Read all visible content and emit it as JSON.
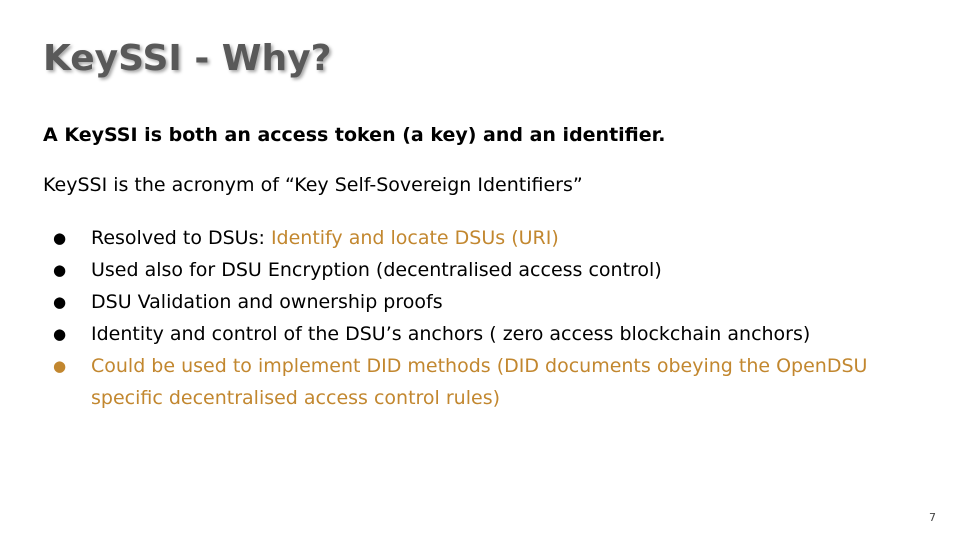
{
  "slide": {
    "title": "KeySSI - Why?",
    "lead": "A KeySSI is both an access token (a key) and an identifier.",
    "sub": "KeySSI is the acronym of “Key Self-Sovereign Identifiers”",
    "bullets": [
      {
        "prefix": "Resolved to DSUs: ",
        "highlight": "Identify and locate DSUs (URI)"
      },
      {
        "prefix": "Used also for DSU Encryption (decentralised access control)",
        "highlight": ""
      },
      {
        "prefix": "DSU Validation and ownership proofs",
        "highlight": ""
      },
      {
        "prefix": "Identity and control of the DSU’s anchors ( zero access blockchain anchors)",
        "highlight": ""
      },
      {
        "prefix": "",
        "highlight": "Could be used to implement DID methods (DID documents obeying  the OpenDSU specific decentralised access control rules)"
      }
    ],
    "bullet_glyph": "●",
    "page_number": "7"
  },
  "colors": {
    "title": "#595959",
    "text": "#000000",
    "accent": "#c2872f",
    "background": "#ffffff"
  }
}
